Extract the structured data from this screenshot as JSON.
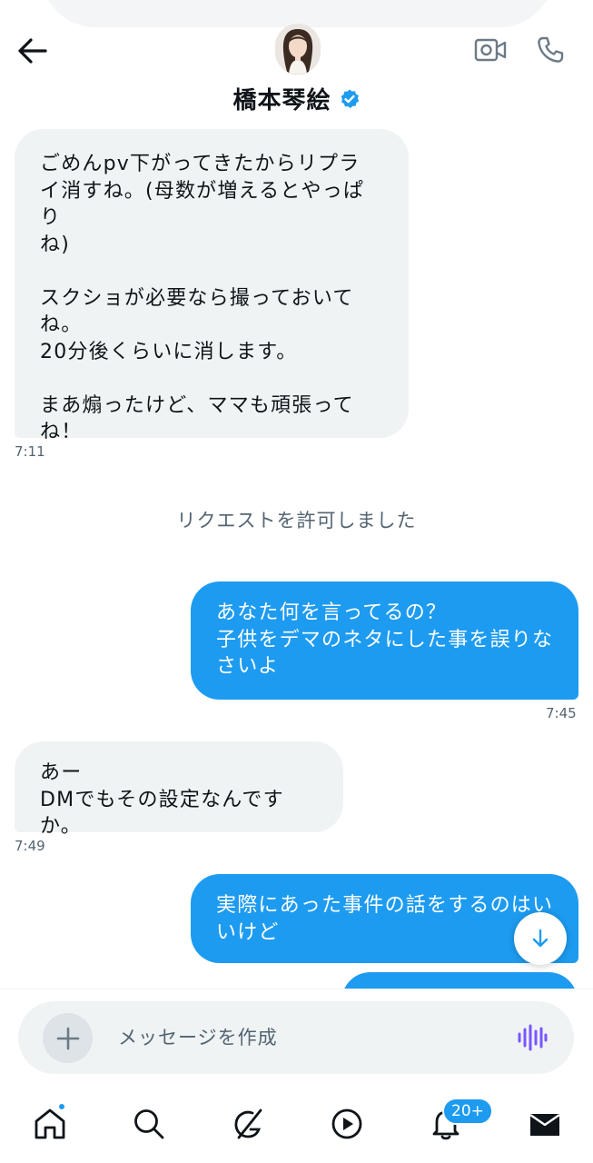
{
  "header": {
    "contact_name": "橋本琴絵",
    "verified": true
  },
  "messages": [
    {
      "direction": "in",
      "text": "ごめんpv下がってきたからリプラ\nイ消すね。(母数が増えるとやっぱり\nね)\n\nスクショが必要なら撮っておいて\nね。\n20分後くらいに消します。\n\nまあ煽ったけど、ママも頑張って\nね！",
      "time": "7:11"
    },
    {
      "direction": "system",
      "text": "リクエストを許可しました"
    },
    {
      "direction": "out",
      "text": "あなた何を言ってるの？\n子供をデマのネタにした事を誤りな\nさいよ",
      "time": "7:45"
    },
    {
      "direction": "in",
      "text": "あー\nDMでもその設定なんですか。",
      "time": "7:49"
    },
    {
      "direction": "out",
      "text": "実際にあった事件の話をするのはい\nいけど",
      "time": ""
    }
  ],
  "composer": {
    "placeholder": "メッセージを作成"
  },
  "tabbar": {
    "notifications_badge": "20+"
  },
  "colors": {
    "accent": "#1d9bf0",
    "incoming_bubble": "#eff3f4",
    "text": "#0f1419",
    "muted": "#536471"
  },
  "icons": [
    "back-arrow-icon",
    "video-call-icon",
    "phone-icon",
    "verified-badge-icon",
    "plus-icon",
    "voice-waveform-icon",
    "arrow-down-icon",
    "home-icon",
    "search-icon",
    "grok-icon",
    "play-icon",
    "bell-icon",
    "mail-icon"
  ]
}
